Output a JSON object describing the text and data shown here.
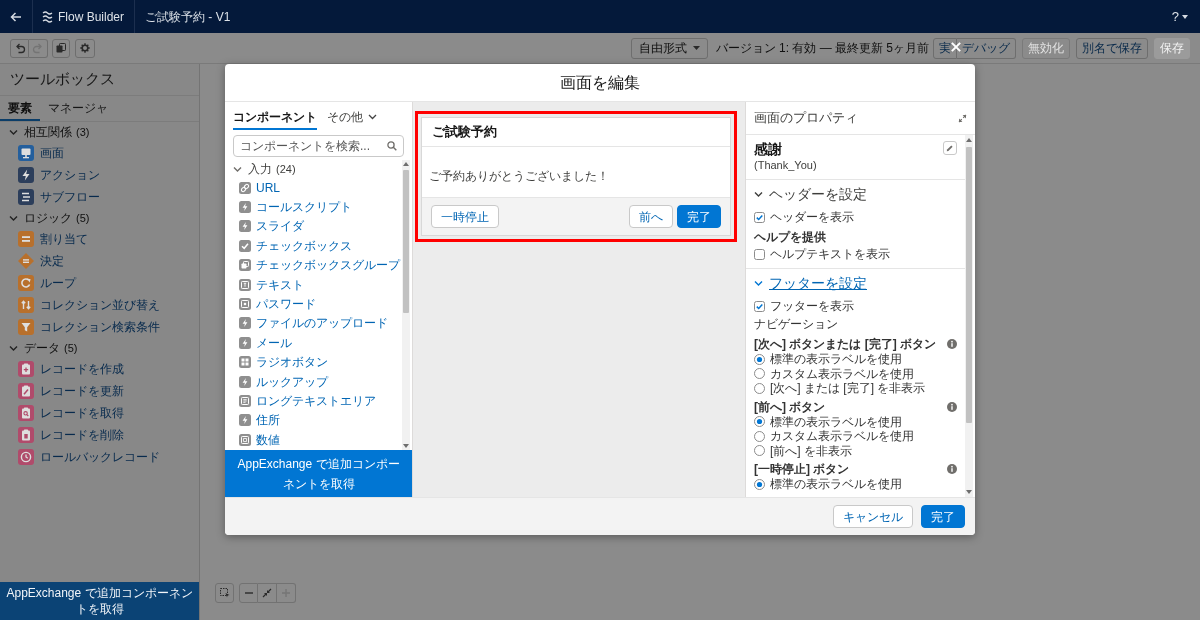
{
  "header": {
    "app_name": "Flow Builder",
    "flow_title": "ご試験予約 - V1",
    "help_label": "?"
  },
  "toolbar": {
    "history": [
      {
        "kind": "undo",
        "disabled": false
      },
      {
        "kind": "redo",
        "disabled": true
      }
    ],
    "layout_mode": "自由形式",
    "version_info": "バージョン 1: 有効 — 最終更新 5ヶ月前",
    "button_groups": [
      [
        {
          "label": "実",
          "kind": "neutral",
          "disabled": false
        },
        {
          "label": "デバッグ",
          "kind": "neutral",
          "disabled": false
        }
      ],
      [
        {
          "label": "無効化",
          "kind": "neutral",
          "disabled": true
        }
      ],
      [
        {
          "label": "別名で保存",
          "kind": "neutral",
          "disabled": false
        }
      ],
      [
        {
          "label": "保存",
          "kind": "brand",
          "disabled": true
        }
      ]
    ]
  },
  "toolbox": {
    "title": "ツールボックス",
    "tabs": [
      {
        "label": "要素",
        "selected": true
      },
      {
        "label": "マネージャ",
        "selected": false
      }
    ],
    "sections": [
      {
        "label": "相互関係",
        "count": "(3)",
        "expanded": true,
        "items": [
          {
            "label": "画面",
            "kind": "screen"
          },
          {
            "label": "アクション",
            "kind": "action"
          },
          {
            "label": "サブフロー",
            "kind": "subflow"
          }
        ]
      },
      {
        "label": "ロジック",
        "count": "(5)",
        "expanded": true,
        "items": [
          {
            "label": "割り当て",
            "kind": "assignment"
          },
          {
            "label": "決定",
            "kind": "decision"
          },
          {
            "label": "ループ",
            "kind": "loop"
          },
          {
            "label": "コレクション並び替え",
            "kind": "sort"
          },
          {
            "label": "コレクション検索条件",
            "kind": "filter"
          }
        ]
      },
      {
        "label": "データ",
        "count": "(5)",
        "expanded": true,
        "items": [
          {
            "label": "レコードを作成",
            "kind": "create"
          },
          {
            "label": "レコードを更新",
            "kind": "update"
          },
          {
            "label": "レコードを取得",
            "kind": "get"
          },
          {
            "label": "レコードを削除",
            "kind": "delete"
          },
          {
            "label": "ロールバックレコード",
            "kind": "rollback"
          }
        ]
      }
    ],
    "appexchange_link": "AppExchange で追加コンポーネントを取得"
  },
  "canvas": {
    "zoom_controls": [
      [
        {
          "kind": "marquee",
          "disabled": false
        }
      ],
      [
        {
          "kind": "zoom_out",
          "disabled": false
        },
        {
          "kind": "fit",
          "disabled": false
        },
        {
          "kind": "zoom_in",
          "disabled": true
        }
      ]
    ]
  },
  "modal": {
    "title": "画面を編集",
    "palette": {
      "tabs": [
        {
          "label": "コンポーネント",
          "selected": true
        },
        {
          "label": "その他",
          "selected": false,
          "dropdown": true
        }
      ],
      "search": {
        "placeholder": "コンポーネントを検索..."
      },
      "sections": [
        {
          "label": "入力",
          "count": "(24)",
          "expanded": true,
          "items": [
            {
              "label": "URL",
              "kind": "link"
            },
            {
              "label": "コールスクリプト",
              "kind": "bolt"
            },
            {
              "label": "スライダ",
              "kind": "bolt"
            },
            {
              "label": "チェックボックス",
              "kind": "check"
            },
            {
              "label": "チェックボックスグループ",
              "kind": "group"
            },
            {
              "label": "テキスト",
              "kind": "text"
            },
            {
              "label": "パスワード",
              "kind": "password"
            },
            {
              "label": "ファイルのアップロード",
              "kind": "bolt"
            },
            {
              "label": "メール",
              "kind": "bolt"
            },
            {
              "label": "ラジオボタン",
              "kind": "radio"
            },
            {
              "label": "ルックアップ",
              "kind": "bolt"
            },
            {
              "label": "ロングテキストエリア",
              "kind": "textarea"
            },
            {
              "label": "住所",
              "kind": "bolt"
            },
            {
              "label": "数値",
              "kind": "number"
            }
          ]
        }
      ],
      "appexchange_link": "AppExchange で追加コンポーネントを取得"
    },
    "preview": {
      "highlighted": true,
      "title": "ご試験予約",
      "message": "ご予約ありがとうございました！",
      "left_buttons": [
        {
          "label": "一時停止",
          "kind": "neutral"
        }
      ],
      "right_buttons": [
        {
          "label": "前へ",
          "kind": "neutral"
        },
        {
          "label": "完了",
          "kind": "brand"
        }
      ]
    },
    "properties": {
      "title": "画面のプロパティ",
      "screen_label": "感謝",
      "api_name": "(Thank_You)",
      "sections": [
        {
          "title": "ヘッダーを設定",
          "expanded": true,
          "focused": false,
          "rows": [
            {
              "kind": "checkbox",
              "label": "ヘッダーを表示",
              "checked": true
            },
            {
              "kind": "group_label",
              "label": "ヘルプを提供"
            },
            {
              "kind": "checkbox",
              "label": "ヘルプテキストを表示",
              "checked": false
            }
          ]
        },
        {
          "title": "フッターを設定",
          "expanded": true,
          "focused": true,
          "rows": [
            {
              "kind": "checkbox",
              "label": "フッターを表示",
              "checked": true
            },
            {
              "kind": "heading",
              "label": "ナビゲーション"
            },
            {
              "kind": "group_label",
              "label": "[次へ] ボタンまたは [完了] ボタン",
              "info": true
            },
            {
              "kind": "radio",
              "label": "標準の表示ラベルを使用",
              "selected": true
            },
            {
              "kind": "radio",
              "label": "カスタム表示ラベルを使用",
              "selected": false
            },
            {
              "kind": "radio",
              "label": "[次へ] または [完了] を非表示",
              "selected": false
            },
            {
              "kind": "group_label",
              "label": "[前へ] ボタン",
              "info": true
            },
            {
              "kind": "radio",
              "label": "標準の表示ラベルを使用",
              "selected": true
            },
            {
              "kind": "radio",
              "label": "カスタム表示ラベルを使用",
              "selected": false
            },
            {
              "kind": "radio",
              "label": "[前へ] を非表示",
              "selected": false
            },
            {
              "kind": "group_label",
              "label": "[一時停止] ボタン",
              "info": true
            },
            {
              "kind": "radio",
              "label": "標準の表示ラベルを使用",
              "selected": true
            }
          ]
        }
      ]
    },
    "footer_buttons": [
      {
        "label": "キャンセル",
        "kind": "neutral"
      },
      {
        "label": "完了",
        "kind": "brand"
      }
    ]
  }
}
